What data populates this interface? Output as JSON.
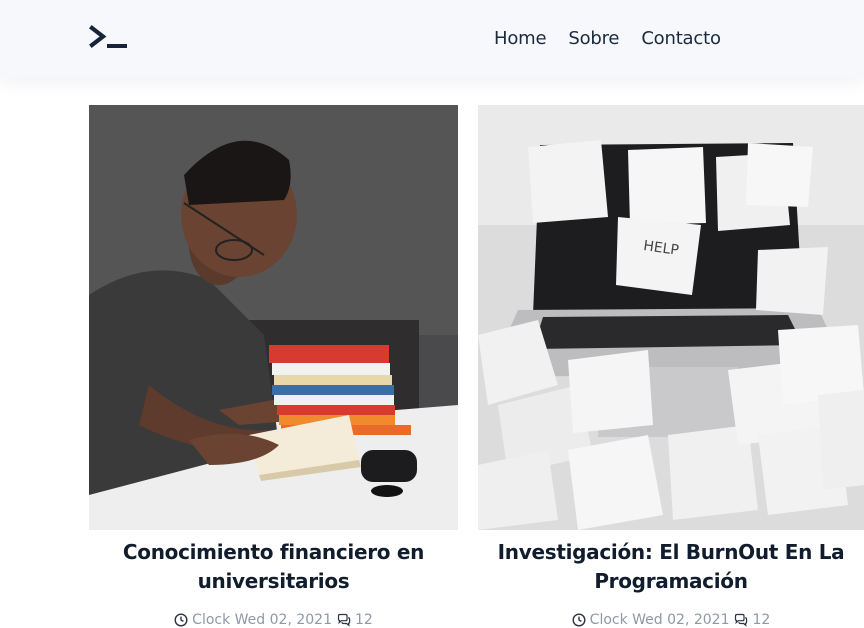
{
  "navbar": {
    "logo_icon": "terminal-prompt-icon",
    "links": [
      {
        "label": "Home"
      },
      {
        "label": "Sobre"
      },
      {
        "label": "Contacto"
      }
    ]
  },
  "posts": [
    {
      "title_line1": "Conocimiento financiero en",
      "title_line2": "universitarios",
      "date_label": "Clock Wed 02, 2021",
      "comments": "12",
      "image_icon": "man-reading-book-photo"
    },
    {
      "title_line1": "Investigación: El BurnOut En La",
      "title_line2": "Programación",
      "date_label": "Clock Wed 02, 2021",
      "comments": "12",
      "image_icon": "laptop-sticky-notes-photo",
      "sticky_note_text": "HELP"
    }
  ],
  "colors": {
    "navbar_bg": "#f6f8fb",
    "text_dark": "#1b2a3d",
    "meta_gray": "#8f98a4"
  }
}
